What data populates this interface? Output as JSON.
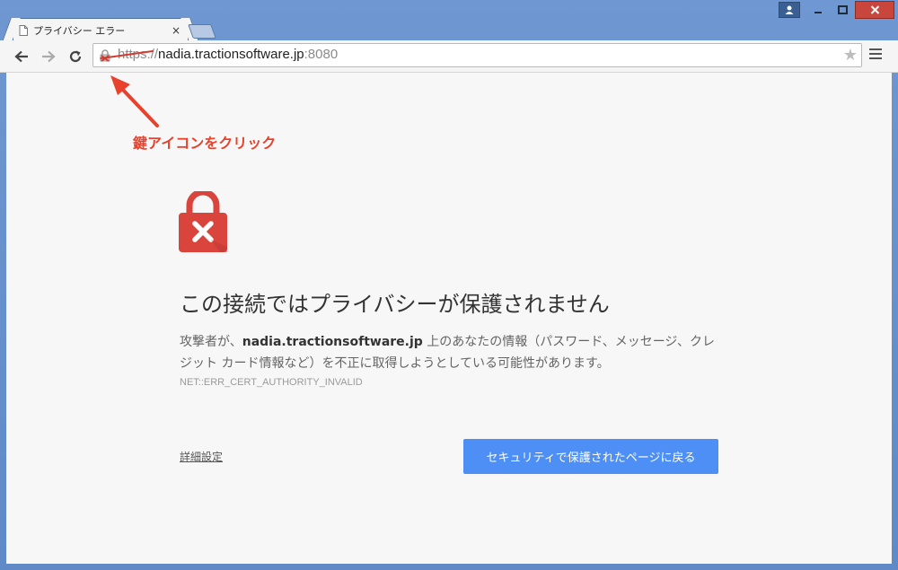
{
  "window": {
    "controls": {
      "user": "👤",
      "minimize": "—",
      "maximize": "☐",
      "close": "✕"
    }
  },
  "tab": {
    "title": "プライバシー エラー",
    "close": "×"
  },
  "toolbar": {
    "back": "←",
    "forward": "→",
    "reload": "↻",
    "url_scheme": "https",
    "url_sep": "://",
    "url_host": "nadia.tractionsoftware.jp",
    "url_port": ":8080",
    "star": "★"
  },
  "annotation": {
    "text": "鍵アイコンをクリック",
    "color": "#e8412c"
  },
  "error": {
    "title": "この接続ではプライバシーが保護されません",
    "desc_prefix": "攻撃者が、",
    "desc_host": "nadia.tractionsoftware.jp",
    "desc_suffix": " 上のあなたの情報（パスワード、メッセージ、クレジット カード情報など）を不正に取得しようとしている可能性があります。",
    "code": "NET::ERR_CERT_AUTHORITY_INVALID",
    "advanced_link": "詳細設定",
    "back_button": "セキュリティで保護されたページに戻る"
  },
  "colors": {
    "lock_red": "#d9453d",
    "button_blue": "#4d8ff5",
    "frame_blue": "#6f97d1"
  }
}
